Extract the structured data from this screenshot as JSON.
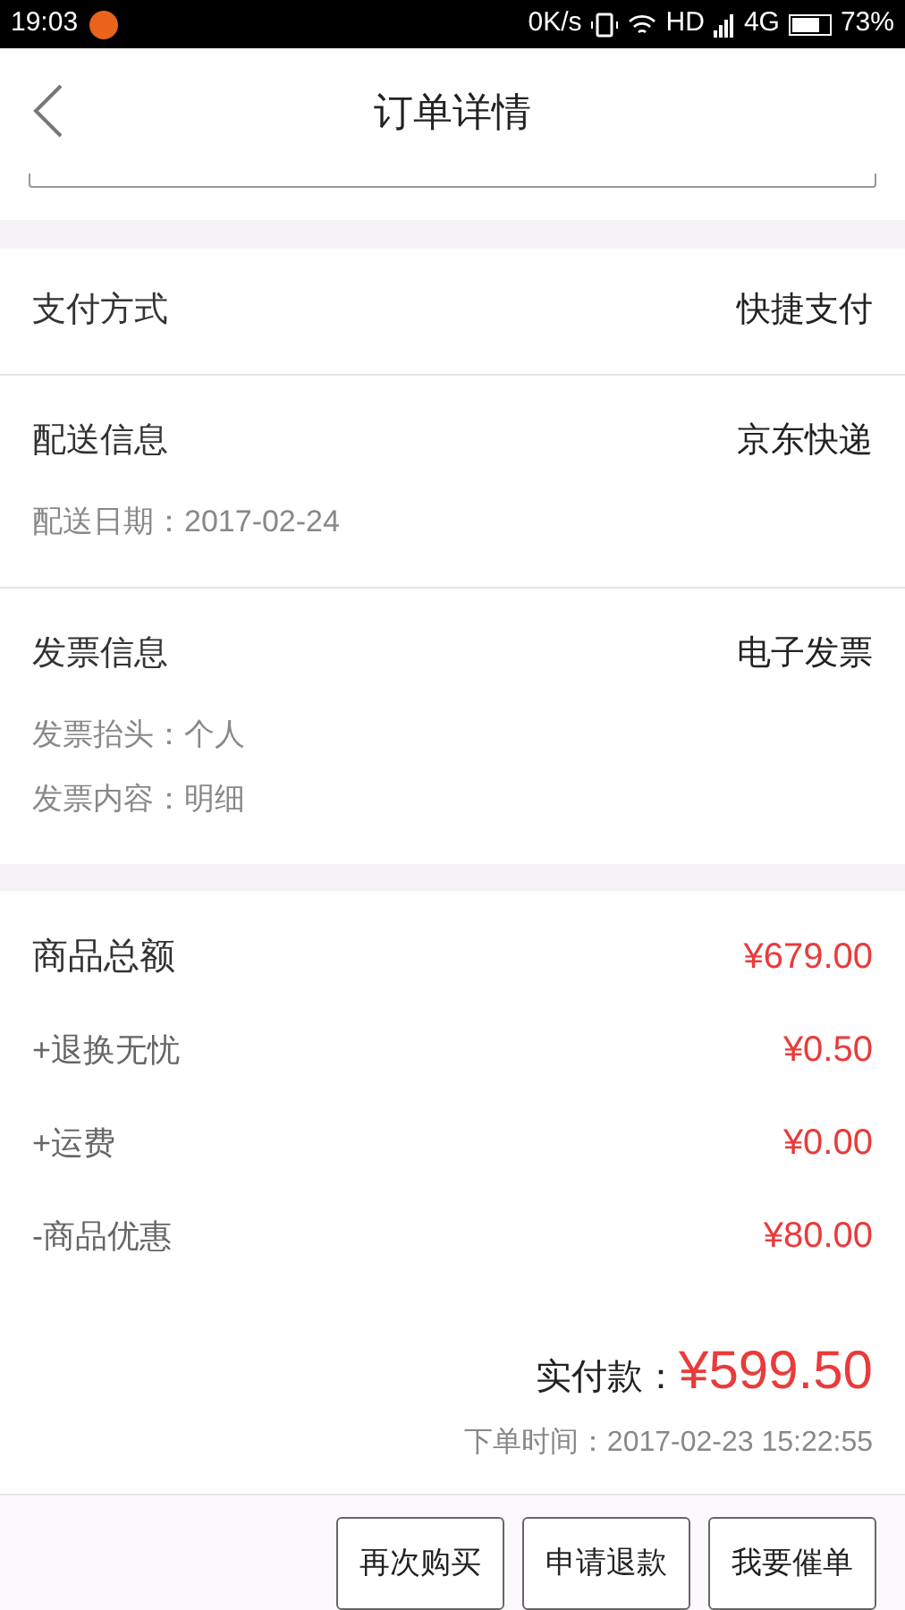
{
  "status_bar": {
    "time": "19:03",
    "speed": "0K/s",
    "network": "HD",
    "network_type": "4G",
    "battery": "73%"
  },
  "header": {
    "title": "订单详情"
  },
  "payment": {
    "label": "支付方式",
    "value": "快捷支付"
  },
  "delivery": {
    "label": "配送信息",
    "value": "京东快递",
    "details": [
      "配送日期：2017-02-24"
    ]
  },
  "invoice": {
    "label": "发票信息",
    "value": "电子发票",
    "details": [
      "发票抬头：个人",
      "发票内容：明细"
    ]
  },
  "amounts": [
    {
      "label": "商品总额",
      "value": "¥679.00",
      "kind": "total"
    },
    {
      "label": "+退换无忧",
      "value": "¥0.50",
      "kind": "item"
    },
    {
      "label": "+运费",
      "value": "¥0.00",
      "kind": "item"
    },
    {
      "label": "-商品优惠",
      "value": "¥80.00",
      "kind": "item"
    }
  ],
  "paid": {
    "label": "实付款：",
    "value": "¥599.50"
  },
  "order_time": "下单时间：2017-02-23 15:22:55",
  "actions": [
    "再次购买",
    "申请退款",
    "我要催单"
  ]
}
